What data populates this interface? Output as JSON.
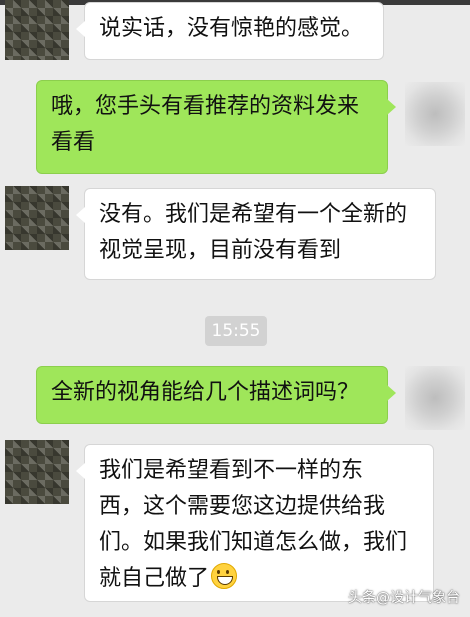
{
  "chat": {
    "messages": [
      {
        "side": "left",
        "lines": [
          "说实话，没有惊艳的感觉。"
        ]
      },
      {
        "side": "right",
        "lines": [
          "哦，您手头有看推荐的资料发来",
          "看看"
        ]
      },
      {
        "side": "left",
        "lines": [
          "没有。我们是希望有一个全新的",
          "视觉呈现，目前没有看到"
        ]
      },
      {
        "side": "right",
        "lines": [
          "全新的视角能给几个描述词吗？"
        ]
      },
      {
        "side": "left",
        "lines": [
          "我们是希望看到不一样的东",
          "西，这个需要您这边提供给我",
          "们。如果我们知道怎么做，我们",
          "就自己做了"
        ]
      }
    ],
    "timestamp": "15:55",
    "emoji": "grin-emoji-icon"
  },
  "watermark": "头条@设计气象台",
  "colors": {
    "background": "#ebebeb",
    "left_bubble": "#ffffff",
    "right_bubble": "#9fe65a",
    "timestamp_bg": "#d2d2d2"
  }
}
